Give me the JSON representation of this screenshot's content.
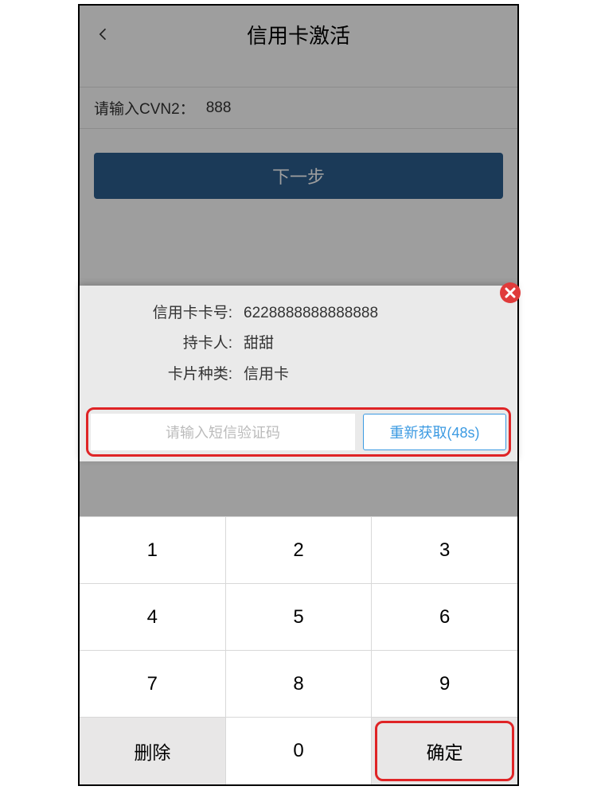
{
  "header": {
    "title": "信用卡激活"
  },
  "cvn": {
    "label": "请输入CVN2：",
    "value": "888"
  },
  "nextButton": "下一步",
  "modal": {
    "cardNumberLabel": "信用卡卡号:",
    "cardNumberValue": "6228888888888888",
    "holderLabel": "持卡人:",
    "holderValue": "甜甜",
    "typeLabel": "卡片种类:",
    "typeValue": "信用卡",
    "smsPlaceholder": "请输入短信验证码",
    "resendLabel": "重新获取(48s)"
  },
  "keypad": {
    "keys": [
      "1",
      "2",
      "3",
      "4",
      "5",
      "6",
      "7",
      "8",
      "9"
    ],
    "delete": "删除",
    "zero": "0",
    "confirm": "确定"
  }
}
